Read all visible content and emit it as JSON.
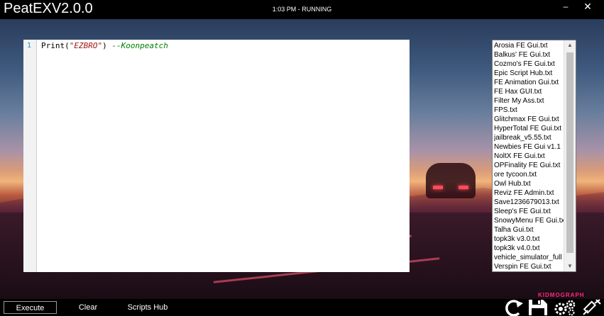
{
  "window": {
    "title": "PeatEXV2.0.0",
    "status": "1:03 PM - RUNNING",
    "minimize_glyph": "–",
    "close_glyph": "✕",
    "watermark": "KIDMOGRAPH"
  },
  "editor": {
    "line_number": "1",
    "code_fn": "Print(",
    "code_string": "\"EZBRO\"",
    "code_close": ")",
    "code_comment": "--Koonpeatch",
    "string_color": "#a31515",
    "comment_color": "#008000"
  },
  "scripts": [
    "Arosia FE Gui.txt",
    "Balkus' FE Gui.txt",
    "Cozmo's FE Gui.txt",
    "Epic Script Hub.txt",
    "FE Animation Gui.txt",
    "FE Hax GUI.txt",
    "Filter My Ass.txt",
    "FPS.txt",
    "Glitchmax FE Gui.txt",
    "HyperTotal FE Gui.txt",
    "jailbreak_v5.55.txt",
    "Newbies FE Gui v1.1",
    "NoltX FE Gui.txt",
    "OPFinality FE Gui.txt",
    "ore tycoon.txt",
    "Owl Hub.txt",
    "Reviz FE Admin.txt",
    "Save1236679013.txt",
    "Sleep's FE Gui.txt",
    "SnowyMenu FE Gui.txt",
    "Talha Gui.txt",
    "topk3k v3.0.txt",
    "topk3k v4.0.txt",
    "vehicle_simulator_full",
    "Verspin FE Gui.txt"
  ],
  "scrollbar": {
    "up_glyph": "▲",
    "down_glyph": "▼"
  },
  "toolbar": {
    "execute": "Execute",
    "clear": "Clear",
    "scripts_hub": "Scripts Hub",
    "icons": [
      "refresh-icon",
      "save-icon",
      "gears-icon",
      "syringe-icon"
    ]
  },
  "colors": {
    "bar_bg": "#000000",
    "watermark": "#ff2a7a"
  }
}
